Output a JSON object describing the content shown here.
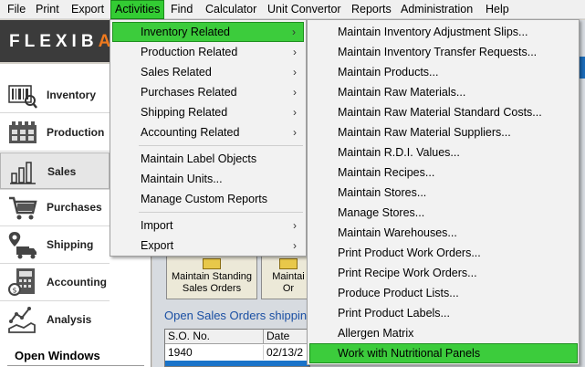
{
  "menubar": {
    "items": [
      "File",
      "Print",
      "Export",
      "Activities",
      "Find",
      "Calculator",
      "Unit Convertor",
      "Reports",
      "Administration",
      "Help"
    ],
    "active": "Activities"
  },
  "logo": {
    "text": "FLEXIB",
    "accent": "A"
  },
  "sidebar": {
    "items": [
      {
        "label": "Inventory",
        "icon": "inventory-icon"
      },
      {
        "label": "Production",
        "icon": "production-icon"
      },
      {
        "label": "Sales",
        "icon": "sales-icon"
      },
      {
        "label": "Purchases",
        "icon": "cart-icon"
      },
      {
        "label": "Shipping",
        "icon": "shipping-icon"
      },
      {
        "label": "Accounting",
        "icon": "calculator-icon"
      },
      {
        "label": "Analysis",
        "icon": "analysis-icon"
      }
    ],
    "selected": "Sales",
    "open_windows": "Open Windows"
  },
  "main": {
    "tiles": [
      {
        "label": "Maintain Standing\nSales Orders"
      },
      {
        "label": "Maintai\nOr"
      }
    ],
    "link": "Open Sales Orders shippin",
    "grid": {
      "headers": [
        "S.O. No.",
        "Date"
      ],
      "row": [
        "1940",
        "02/13/2"
      ]
    }
  },
  "activities_menu": {
    "items": [
      {
        "label": "Inventory Related",
        "submenu": true
      },
      {
        "label": "Production Related",
        "submenu": true
      },
      {
        "label": "Sales Related",
        "submenu": true
      },
      {
        "label": "Purchases Related",
        "submenu": true
      },
      {
        "label": "Shipping Related",
        "submenu": true
      },
      {
        "label": "Accounting Related",
        "submenu": true
      },
      {
        "label": "Maintain Label Objects",
        "submenu": false
      },
      {
        "label": "Maintain Units...",
        "submenu": false
      },
      {
        "label": "Manage Custom Reports",
        "submenu": false
      },
      {
        "label": "Import",
        "submenu": true
      },
      {
        "label": "Export",
        "submenu": true
      }
    ],
    "highlighted": "Inventory Related"
  },
  "inventory_submenu": {
    "items": [
      "Maintain Inventory Adjustment Slips...",
      "Maintain Inventory Transfer Requests...",
      "Maintain Products...",
      "Maintain Raw Materials...",
      "Maintain Raw Material Standard Costs...",
      "Maintain Raw Material Suppliers...",
      "Maintain R.D.I. Values...",
      "Maintain Recipes...",
      "Maintain Stores...",
      "Manage Stores...",
      "Maintain Warehouses...",
      "Print Product Work Orders...",
      "Print Recipe Work Orders...",
      "Produce Product Lists...",
      "Print Product Labels...",
      "Allergen Matrix",
      "Work with Nutritional Panels"
    ],
    "highlighted": "Work with Nutritional Panels"
  },
  "colors": {
    "highlight": "#3ccc3c",
    "header_blue": "#1b6bb8",
    "logo_bg": "#3b3b3b",
    "logo_accent": "#f07a1e"
  }
}
